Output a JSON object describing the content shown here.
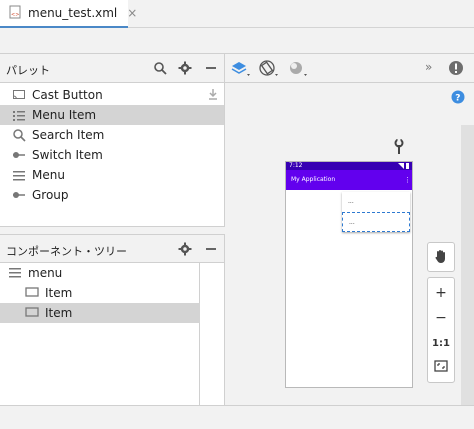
{
  "file_tab": {
    "label": "menu_test.xml",
    "close": "×"
  },
  "palette": {
    "title": "パレット",
    "items": [
      {
        "label": "Cast Button",
        "icon": "cast-icon"
      },
      {
        "label": "Menu Item",
        "icon": "list-icon",
        "selected": true
      },
      {
        "label": "Search Item",
        "icon": "search-icon"
      },
      {
        "label": "Switch Item",
        "icon": "switch-icon"
      },
      {
        "label": "Menu",
        "icon": "menu-icon"
      },
      {
        "label": "Group",
        "icon": "group-icon"
      }
    ]
  },
  "tree": {
    "title": "コンポーネント・ツリー",
    "items": [
      {
        "label": "menu",
        "depth": 0
      },
      {
        "label": "Item",
        "depth": 1
      },
      {
        "label": "Item",
        "depth": 1,
        "selected": true
      }
    ]
  },
  "preview": {
    "status_time": "7:12",
    "app_title": "My Application",
    "menu_rows": [
      "...",
      "..."
    ]
  },
  "zoom": {
    "hand": "pan-icon",
    "plus": "+",
    "minus": "−",
    "ratio": "1:1",
    "fit": "fit-screen-icon"
  },
  "colors": {
    "accent": "#6200ee",
    "status": "#3700b3",
    "selection": "#d4d4d4",
    "info": "#3d8de0"
  }
}
